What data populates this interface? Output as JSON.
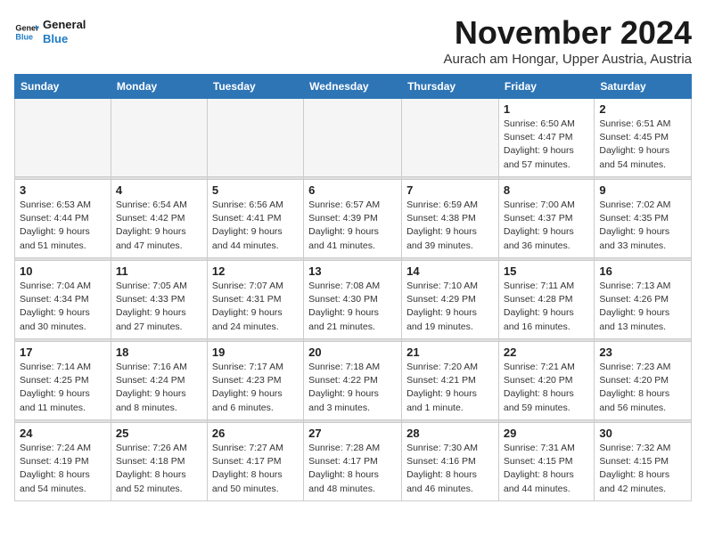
{
  "logo": {
    "line1": "General",
    "line2": "Blue"
  },
  "title": "November 2024",
  "location": "Aurach am Hongar, Upper Austria, Austria",
  "weekdays": [
    "Sunday",
    "Monday",
    "Tuesday",
    "Wednesday",
    "Thursday",
    "Friday",
    "Saturday"
  ],
  "weeks": [
    [
      {
        "day": "",
        "info": ""
      },
      {
        "day": "",
        "info": ""
      },
      {
        "day": "",
        "info": ""
      },
      {
        "day": "",
        "info": ""
      },
      {
        "day": "",
        "info": ""
      },
      {
        "day": "1",
        "info": "Sunrise: 6:50 AM\nSunset: 4:47 PM\nDaylight: 9 hours and 57 minutes."
      },
      {
        "day": "2",
        "info": "Sunrise: 6:51 AM\nSunset: 4:45 PM\nDaylight: 9 hours and 54 minutes."
      }
    ],
    [
      {
        "day": "3",
        "info": "Sunrise: 6:53 AM\nSunset: 4:44 PM\nDaylight: 9 hours and 51 minutes."
      },
      {
        "day": "4",
        "info": "Sunrise: 6:54 AM\nSunset: 4:42 PM\nDaylight: 9 hours and 47 minutes."
      },
      {
        "day": "5",
        "info": "Sunrise: 6:56 AM\nSunset: 4:41 PM\nDaylight: 9 hours and 44 minutes."
      },
      {
        "day": "6",
        "info": "Sunrise: 6:57 AM\nSunset: 4:39 PM\nDaylight: 9 hours and 41 minutes."
      },
      {
        "day": "7",
        "info": "Sunrise: 6:59 AM\nSunset: 4:38 PM\nDaylight: 9 hours and 39 minutes."
      },
      {
        "day": "8",
        "info": "Sunrise: 7:00 AM\nSunset: 4:37 PM\nDaylight: 9 hours and 36 minutes."
      },
      {
        "day": "9",
        "info": "Sunrise: 7:02 AM\nSunset: 4:35 PM\nDaylight: 9 hours and 33 minutes."
      }
    ],
    [
      {
        "day": "10",
        "info": "Sunrise: 7:04 AM\nSunset: 4:34 PM\nDaylight: 9 hours and 30 minutes."
      },
      {
        "day": "11",
        "info": "Sunrise: 7:05 AM\nSunset: 4:33 PM\nDaylight: 9 hours and 27 minutes."
      },
      {
        "day": "12",
        "info": "Sunrise: 7:07 AM\nSunset: 4:31 PM\nDaylight: 9 hours and 24 minutes."
      },
      {
        "day": "13",
        "info": "Sunrise: 7:08 AM\nSunset: 4:30 PM\nDaylight: 9 hours and 21 minutes."
      },
      {
        "day": "14",
        "info": "Sunrise: 7:10 AM\nSunset: 4:29 PM\nDaylight: 9 hours and 19 minutes."
      },
      {
        "day": "15",
        "info": "Sunrise: 7:11 AM\nSunset: 4:28 PM\nDaylight: 9 hours and 16 minutes."
      },
      {
        "day": "16",
        "info": "Sunrise: 7:13 AM\nSunset: 4:26 PM\nDaylight: 9 hours and 13 minutes."
      }
    ],
    [
      {
        "day": "17",
        "info": "Sunrise: 7:14 AM\nSunset: 4:25 PM\nDaylight: 9 hours and 11 minutes."
      },
      {
        "day": "18",
        "info": "Sunrise: 7:16 AM\nSunset: 4:24 PM\nDaylight: 9 hours and 8 minutes."
      },
      {
        "day": "19",
        "info": "Sunrise: 7:17 AM\nSunset: 4:23 PM\nDaylight: 9 hours and 6 minutes."
      },
      {
        "day": "20",
        "info": "Sunrise: 7:18 AM\nSunset: 4:22 PM\nDaylight: 9 hours and 3 minutes."
      },
      {
        "day": "21",
        "info": "Sunrise: 7:20 AM\nSunset: 4:21 PM\nDaylight: 9 hours and 1 minute."
      },
      {
        "day": "22",
        "info": "Sunrise: 7:21 AM\nSunset: 4:20 PM\nDaylight: 8 hours and 59 minutes."
      },
      {
        "day": "23",
        "info": "Sunrise: 7:23 AM\nSunset: 4:20 PM\nDaylight: 8 hours and 56 minutes."
      }
    ],
    [
      {
        "day": "24",
        "info": "Sunrise: 7:24 AM\nSunset: 4:19 PM\nDaylight: 8 hours and 54 minutes."
      },
      {
        "day": "25",
        "info": "Sunrise: 7:26 AM\nSunset: 4:18 PM\nDaylight: 8 hours and 52 minutes."
      },
      {
        "day": "26",
        "info": "Sunrise: 7:27 AM\nSunset: 4:17 PM\nDaylight: 8 hours and 50 minutes."
      },
      {
        "day": "27",
        "info": "Sunrise: 7:28 AM\nSunset: 4:17 PM\nDaylight: 8 hours and 48 minutes."
      },
      {
        "day": "28",
        "info": "Sunrise: 7:30 AM\nSunset: 4:16 PM\nDaylight: 8 hours and 46 minutes."
      },
      {
        "day": "29",
        "info": "Sunrise: 7:31 AM\nSunset: 4:15 PM\nDaylight: 8 hours and 44 minutes."
      },
      {
        "day": "30",
        "info": "Sunrise: 7:32 AM\nSunset: 4:15 PM\nDaylight: 8 hours and 42 minutes."
      }
    ]
  ]
}
